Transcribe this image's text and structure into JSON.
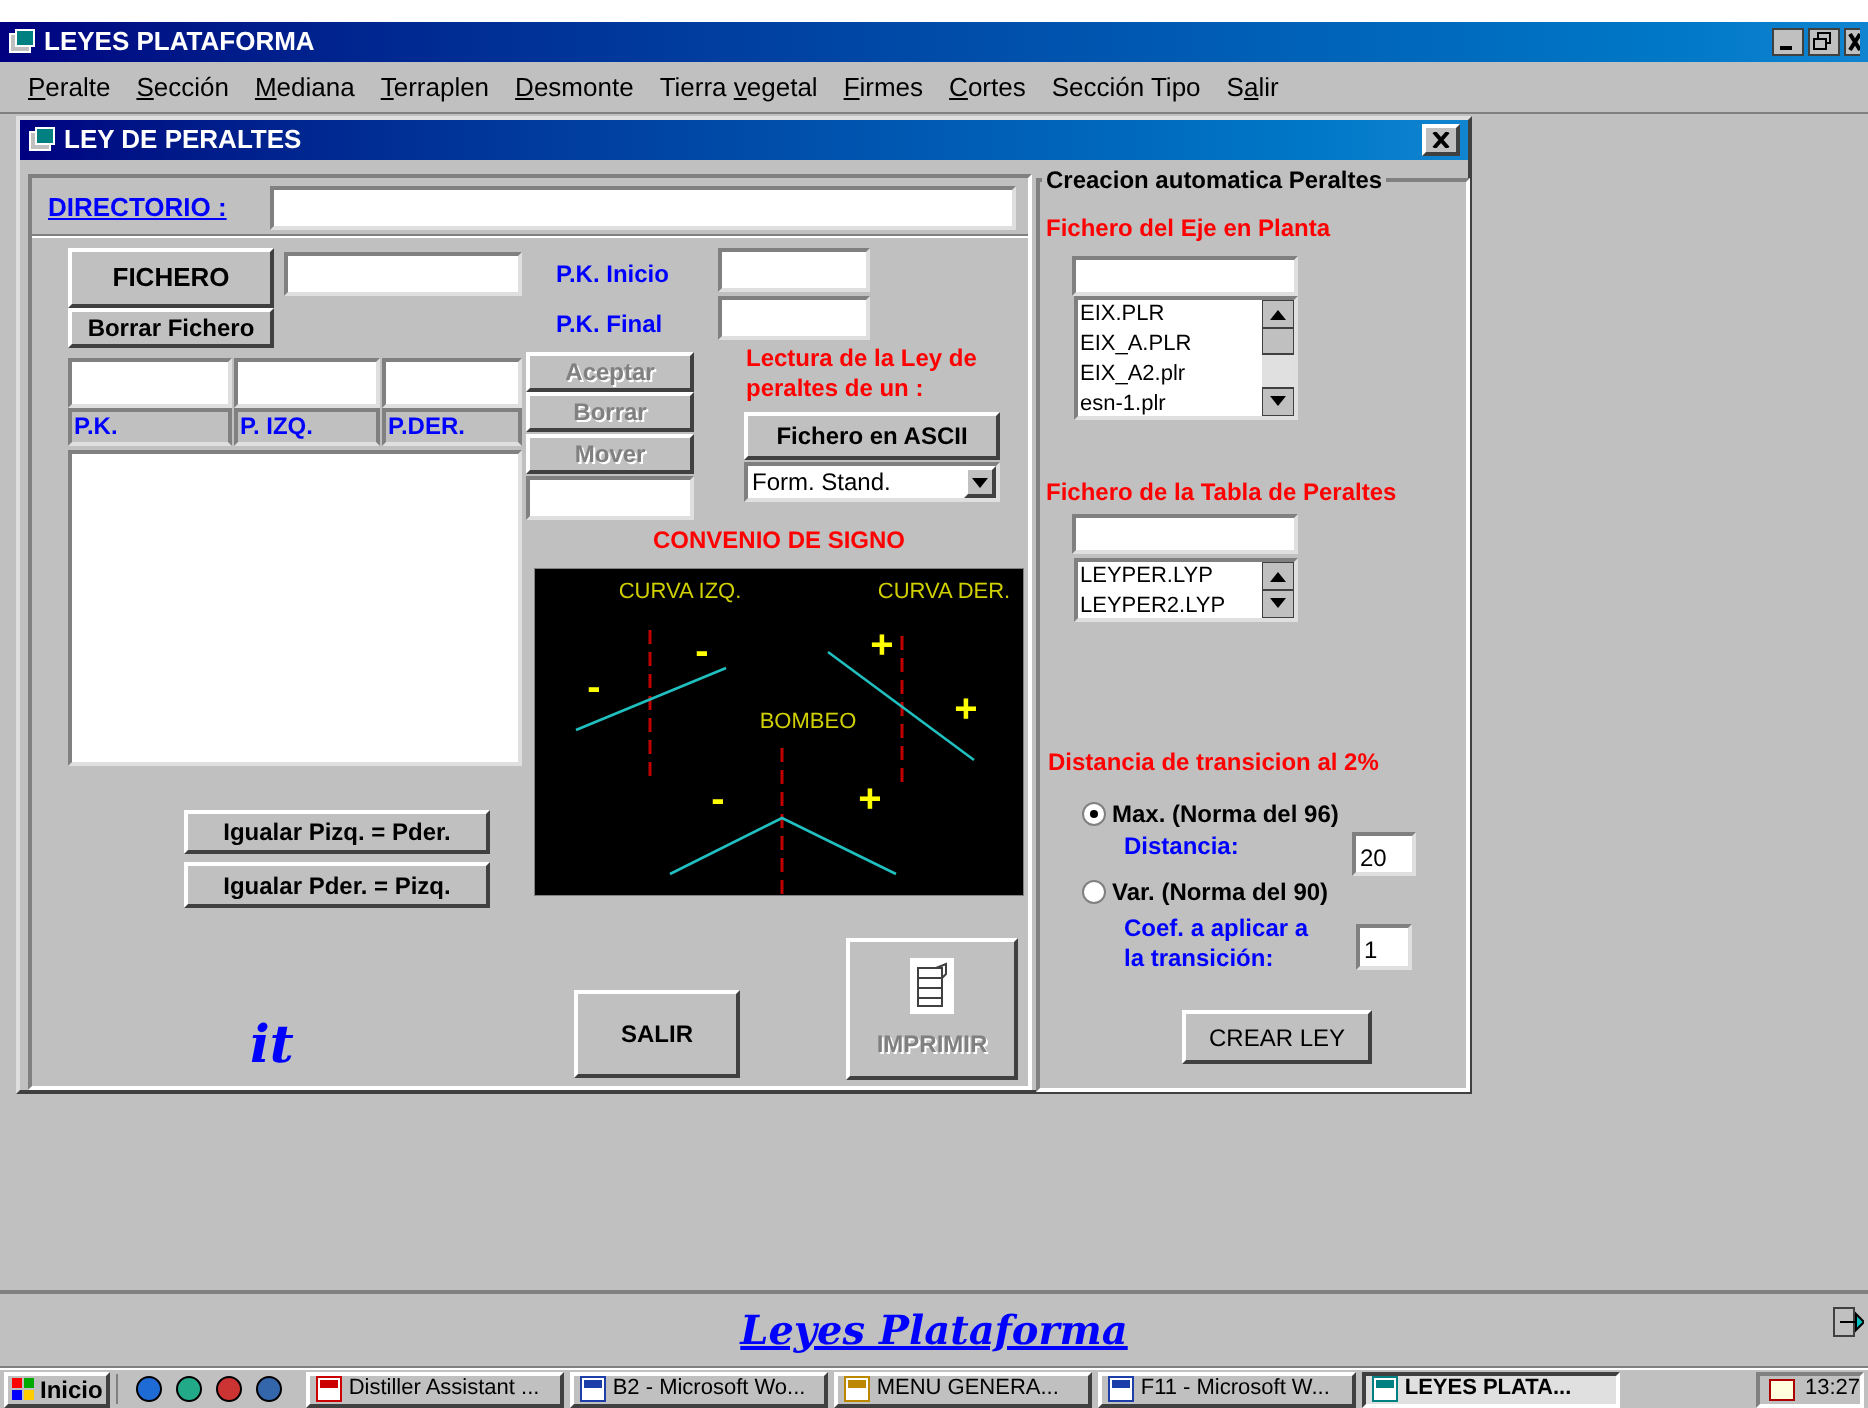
{
  "app_window": {
    "title": "LEYES PLATAFORMA"
  },
  "menu": [
    {
      "key": "P",
      "post": "eralte"
    },
    {
      "key": "S",
      "post": "ección"
    },
    {
      "key": "M",
      "post": "ediana"
    },
    {
      "key": "T",
      "post": "erraplen"
    },
    {
      "key": "D",
      "post": "esmonte"
    },
    {
      "pre": "Tierra ",
      "key": "v",
      "post": "egetal"
    },
    {
      "key": "F",
      "post": "irmes"
    },
    {
      "key": "C",
      "post": "ortes"
    },
    {
      "pre": "Sección Tipo"
    },
    {
      "pre": "S",
      "key": "a",
      "post": "lir"
    }
  ],
  "dialog": {
    "title": "LEY DE PERALTES",
    "directory_label": "DIRECTORIO :",
    "pk_inicio_label": "P.K. Inicio",
    "pk_final_label": "P.K. Final",
    "table_columns": [
      "P.K.",
      "P. IZQ.",
      "P.DER."
    ],
    "reading_note": "Lectura de la Ley de peraltes de un :",
    "format_combo": {
      "value": "Form. Stand."
    },
    "sign_convention": {
      "title": "CONVENIO DE SIGNO",
      "labels": [
        "CURVA IZQ.",
        "CURVA DER.",
        "BOMBEO"
      ],
      "signs": [
        "-",
        "-",
        "+",
        "+",
        "-",
        "+"
      ]
    },
    "buttons": [
      {
        "label": "FICHERO",
        "disabled": false
      },
      {
        "label": "Borrar Fichero",
        "disabled": false
      },
      {
        "label": "Aceptar",
        "disabled": true
      },
      {
        "label": "Borrar",
        "disabled": true
      },
      {
        "label": "Mover",
        "disabled": true
      },
      {
        "label": "Fichero en ASCII",
        "disabled": false
      },
      {
        "label": "Igualar Pizq. = Pder.",
        "disabled": false
      },
      {
        "label": "Igualar Pder. = Pizq.",
        "disabled": false
      },
      {
        "label": "SALIR",
        "disabled": false
      },
      {
        "label": "IMPRIMIR",
        "disabled": true
      }
    ],
    "auto_panel": {
      "title": "Creacion automatica Peraltes",
      "axis_files": {
        "heading": "Fichero del Eje en Planta",
        "items": [
          "EIX.PLR",
          "EIX_A.PLR",
          "EIX_A2.plr",
          "esn-1.plr"
        ]
      },
      "table_files": {
        "heading": "Fichero de la Tabla de Peraltes",
        "items": [
          "LEYPER.LYP",
          "LEYPER2.LYP"
        ]
      },
      "transition_heading": "Distancia de transicion al 2%",
      "options": [
        {
          "label": "Max. (Norma del 96)",
          "selected": true,
          "field_label": "Distancia:",
          "value": "20"
        },
        {
          "label": "Var. (Norma del 90)",
          "selected": false,
          "field_label": "Coef. a aplicar a la transición:",
          "value": "1"
        }
      ],
      "create_button": {
        "label": "CREAR LEY",
        "disabled": false
      }
    }
  },
  "logo_text": "it",
  "status_strip": {
    "title": "Leyes Plataforma"
  },
  "taskbar": {
    "start": "Inicio",
    "tasks": [
      {
        "label": "Distiller Assistant ...",
        "selected": false
      },
      {
        "label": "B2 - Microsoft Wo...",
        "selected": false
      },
      {
        "label": "MENU GENERA...",
        "selected": false
      },
      {
        "label": "F11 - Microsoft W...",
        "selected": false
      },
      {
        "label": "LEYES PLATA...",
        "selected": true
      }
    ],
    "clock": "13:27"
  }
}
